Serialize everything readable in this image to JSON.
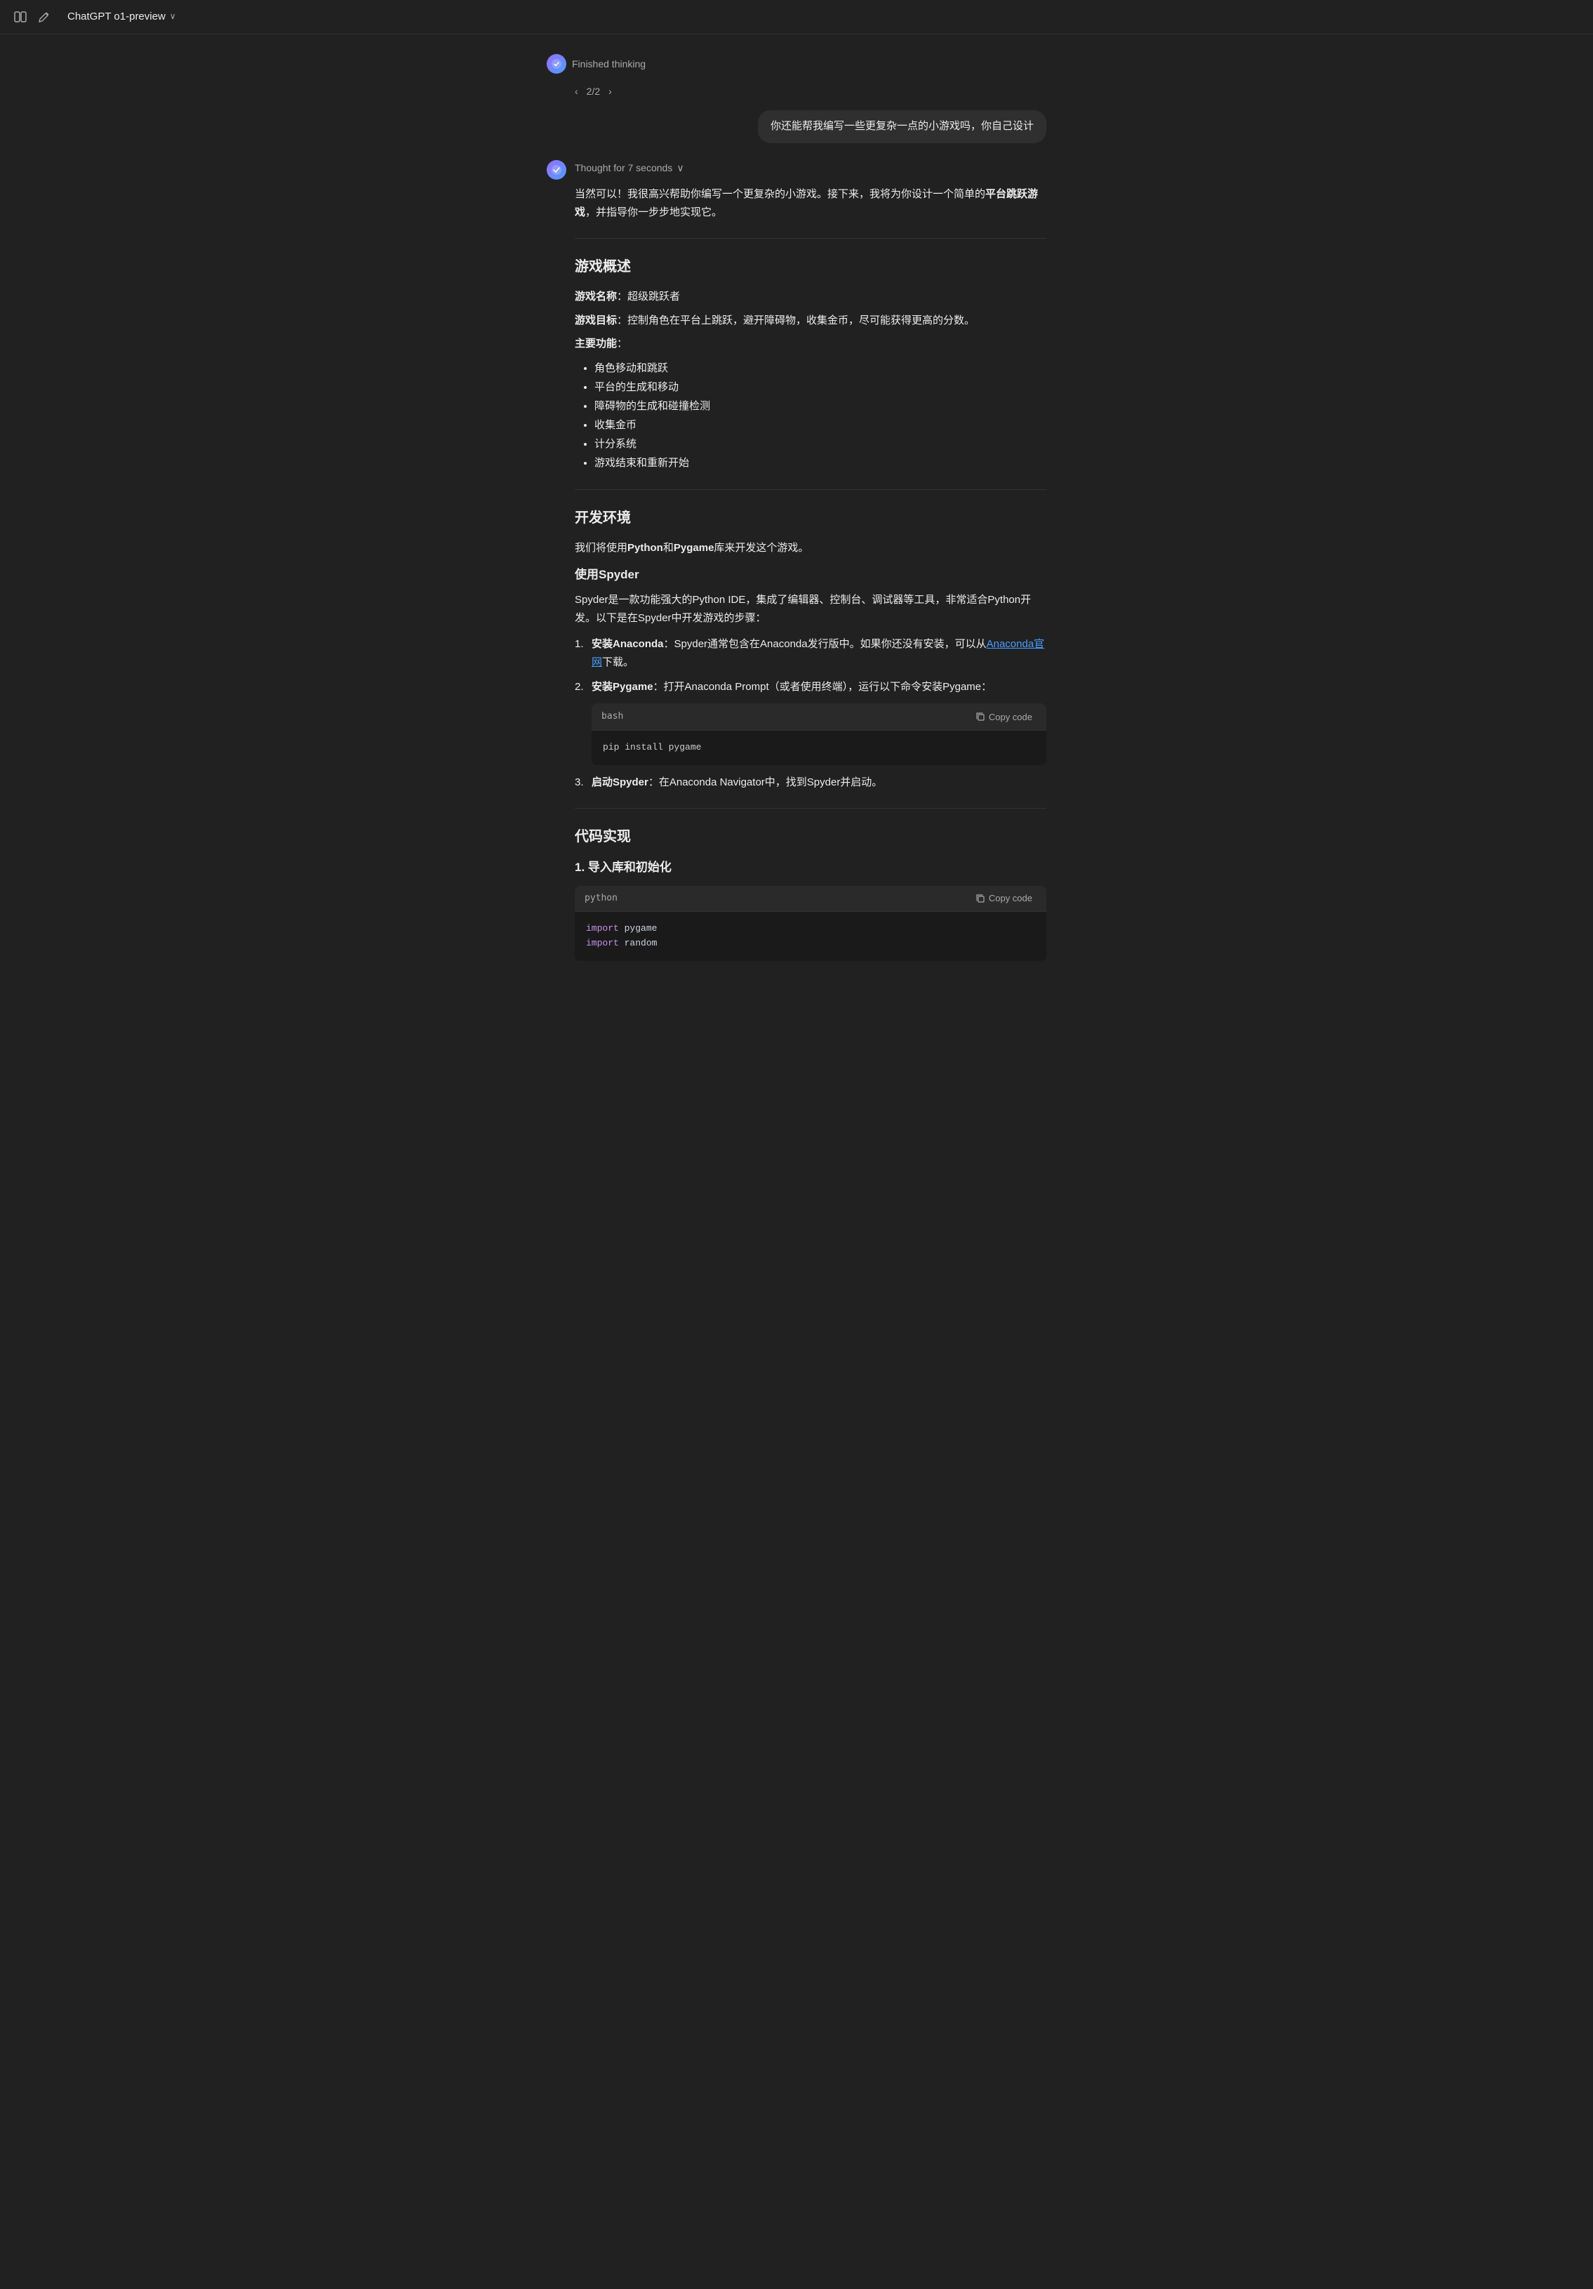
{
  "topbar": {
    "model_name": "ChatGPT o1-preview",
    "chevron": "∨"
  },
  "finished_thinking": "Finished thinking",
  "pagination": {
    "current": "2/2",
    "prev": "‹",
    "next": "›"
  },
  "user_message": "你还能帮我编写一些更复杂一点的小游戏吗，你自己设计",
  "thought_header": "Thought for 7 seconds",
  "intro_text": "当然可以！我很高兴帮助你编写一个更复杂的小游戏。接下来，我将为你设计一个简单的",
  "intro_bold": "平台跳跃游戏",
  "intro_suffix": "，并指导你一步步地实现它。",
  "section1": {
    "heading": "游戏概述",
    "name_label": "游戏名称",
    "name_value": "超级跳跃者",
    "goal_label": "游戏目标",
    "goal_value": "控制角色在平台上跳跃，避开障碍物，收集金币，尽可能获得更高的分数。",
    "features_label": "主要功能",
    "features": [
      "角色移动和跳跃",
      "平台的生成和移动",
      "障碍物的生成和碰撞检测",
      "收集金币",
      "计分系统",
      "游戏结束和重新开始"
    ]
  },
  "section2": {
    "heading": "开发环境",
    "intro": "我们将使用Python和Pygame库来开发这个游戏。",
    "spyder_heading": "使用Spyder",
    "spyder_intro": "Spyder是一款功能强大的Python IDE，集成了编辑器、控制台、调试器等工具，非常适合Python开发。以下是在Spyder中开发游戏的步骤：",
    "steps": [
      {
        "num": 1,
        "bold": "安装Anaconda",
        "text": "：Spyder通常包含在Anaconda发行版中。如果你还没有安装，可以从",
        "link_text": "Anaconda官网",
        "link_suffix": "下载。"
      },
      {
        "num": 2,
        "bold": "安装Pygame",
        "text": "：打开Anaconda Prompt（或者使用终端），运行以下命令安装Pygame："
      },
      {
        "num": 3,
        "bold": "启动Spyder",
        "text": "：在Anaconda Navigator中，找到Spyder并启动。"
      }
    ],
    "bash_lang": "bash",
    "bash_code": "pip install pygame",
    "copy_label": "Copy code"
  },
  "section3": {
    "heading": "代码实现",
    "subheading": "1. 导入库和初始化",
    "python_lang": "python",
    "copy_label": "Copy code",
    "python_lines": [
      {
        "keyword": "import",
        "text": " pygame"
      },
      {
        "keyword": "import",
        "text": " random"
      }
    ]
  }
}
